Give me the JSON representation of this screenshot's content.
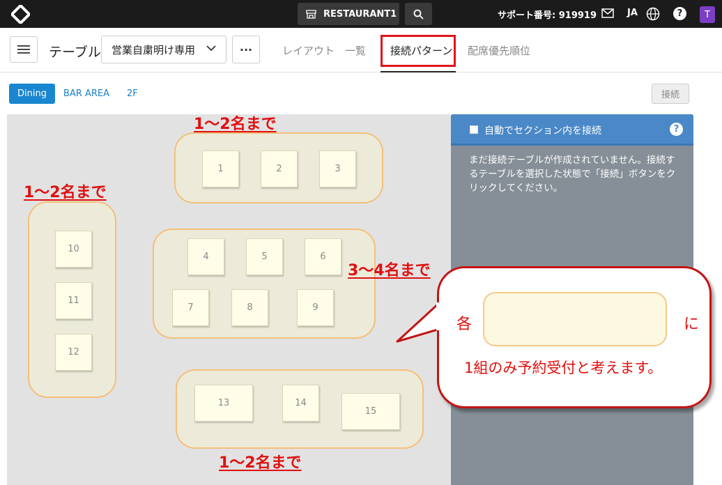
{
  "topbar": {
    "restaurant": "RESTAURANT1",
    "support_label": "サポート番号: 919919",
    "language": "JA",
    "help": "?",
    "avatar": "T"
  },
  "subbar": {
    "title": "テーブル",
    "dropdown_value": "営業自粛明け専用",
    "more": "···",
    "tabs": [
      {
        "label": "レイアウト",
        "active": false
      },
      {
        "label": "一覧",
        "active": false
      },
      {
        "label": "接続パターン",
        "active": true
      },
      {
        "label": "配席優先順位",
        "active": false
      }
    ]
  },
  "sections": {
    "tabs": [
      {
        "label": "Dining",
        "active": true
      },
      {
        "label": "BAR AREA",
        "active": false
      },
      {
        "label": "2F",
        "active": false
      }
    ],
    "connect_button": "接続"
  },
  "tables": [
    "1",
    "2",
    "3",
    "4",
    "5",
    "6",
    "7",
    "8",
    "9",
    "10",
    "11",
    "12",
    "13",
    "14",
    "15"
  ],
  "annotations": {
    "top": "1～2名まで",
    "left": "1～2名まで",
    "middle": "3～4名まで",
    "bottom": "1～2名まで"
  },
  "panel": {
    "checkbox_label": "自動でセクション内を接続",
    "help": "?",
    "message": "まだ接続テーブルが作成されていません。接続するテーブルを選択した状態で「接続」ボタンをクリックしてください。"
  },
  "callout": {
    "prefix": "各",
    "suffix": "に",
    "line": "1組のみ予約受付と考えます。"
  },
  "colors": {
    "accent_blue": "#1a86cf",
    "panel_header": "#4a88c7",
    "annotation_red": "#e01010",
    "group_border": "#f4bf79"
  }
}
